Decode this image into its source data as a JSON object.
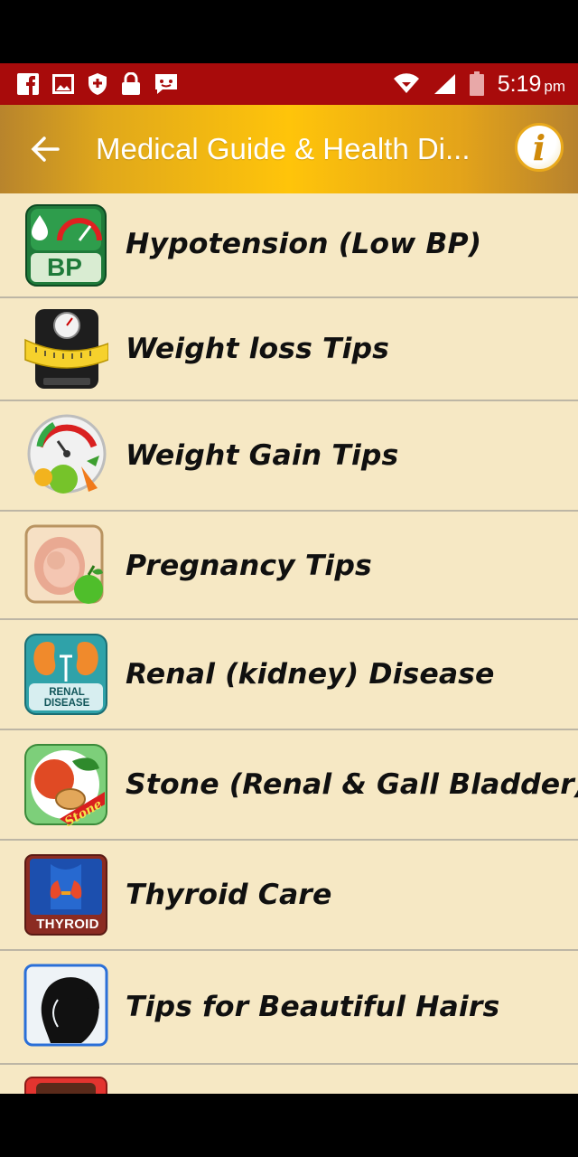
{
  "status_bar": {
    "time": "5:19",
    "ampm": "pm",
    "left_icons": [
      "facebook-icon",
      "gallery-icon",
      "shield-icon",
      "lock-icon",
      "chat-icon"
    ],
    "right_icons": [
      "wifi-icon",
      "signal-icon",
      "battery-icon"
    ],
    "color": "#a80b0b"
  },
  "app_bar": {
    "title": "Medical Guide & Health Di...",
    "back_icon": "arrow-left-icon",
    "info_icon": "info-icon",
    "info_glyph": "i"
  },
  "list": {
    "items": [
      {
        "label": "Hypotension (Low BP)",
        "icon": "bp-gauge-icon"
      },
      {
        "label": "Weight loss Tips",
        "icon": "scale-tape-icon"
      },
      {
        "label": "Weight Gain Tips",
        "icon": "gauge-fruits-icon"
      },
      {
        "label": "Pregnancy Tips",
        "icon": "pregnancy-apple-icon"
      },
      {
        "label": "Renal (kidney) Disease",
        "icon": "kidney-icon",
        "icon_text": "RENAL DISEASE"
      },
      {
        "label": "Stone (Renal & Gall Bladder)",
        "icon": "stone-fruit-icon",
        "icon_text": "Stone"
      },
      {
        "label": "Thyroid Care",
        "icon": "thyroid-icon",
        "icon_text": "THYROID"
      },
      {
        "label": "Tips for Beautiful Hairs",
        "icon": "hair-silhouette-icon"
      }
    ]
  },
  "colors": {
    "list_background": "#f6e8c4",
    "appbar_gold": "#ffc40a",
    "divider": "#bdb6a5"
  }
}
